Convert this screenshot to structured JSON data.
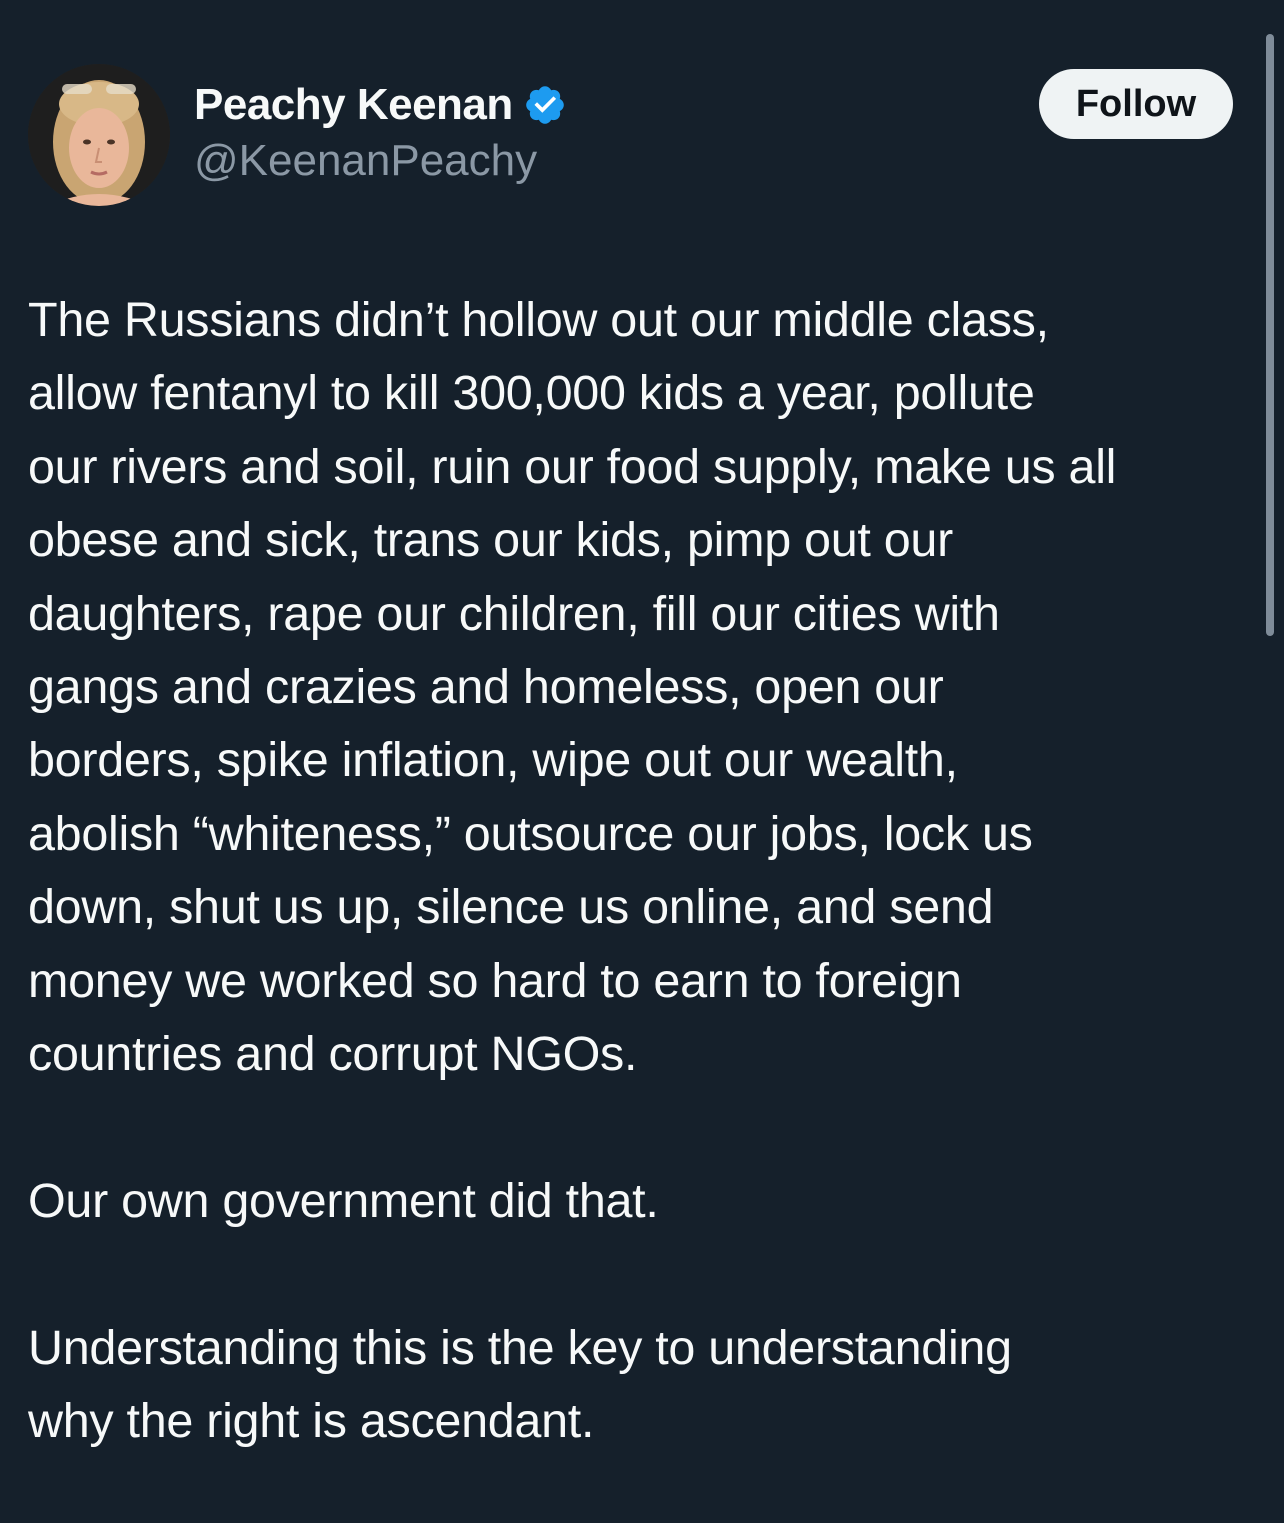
{
  "tweet": {
    "author": {
      "display_name": "Peachy Keenan",
      "handle": "@KeenanPeachy",
      "verified": true,
      "avatar_icon": "profile-photo"
    },
    "follow_label": "Follow",
    "paragraphs": [
      "The Russians didn’t hollow out our middle class,\nallow fentanyl to kill 300,000 kids a year, pollute\nour rivers and soil, ruin our food supply, make us all\nobese and sick, trans our kids, pimp out our\ndaughters, rape our children, fill our cities with\ngangs and crazies and homeless, open our\nborders, spike inflation, wipe out our wealth,\nabolish “whiteness,” outsource our jobs, lock us\ndown, shut us up, silence us online, and send\nmoney we worked so hard to earn to foreign\ncountries and corrupt NGOs.",
      "Our own government did that.",
      "Understanding this is the key to understanding\nwhy the right is ascendant."
    ]
  },
  "colors": {
    "background": "#15202b",
    "text": "#f7f9f9",
    "secondary_text": "#8b98a5",
    "verified_badge": "#1d9bf0",
    "follow_button_bg": "#eff3f4",
    "follow_button_text": "#0f1419"
  }
}
